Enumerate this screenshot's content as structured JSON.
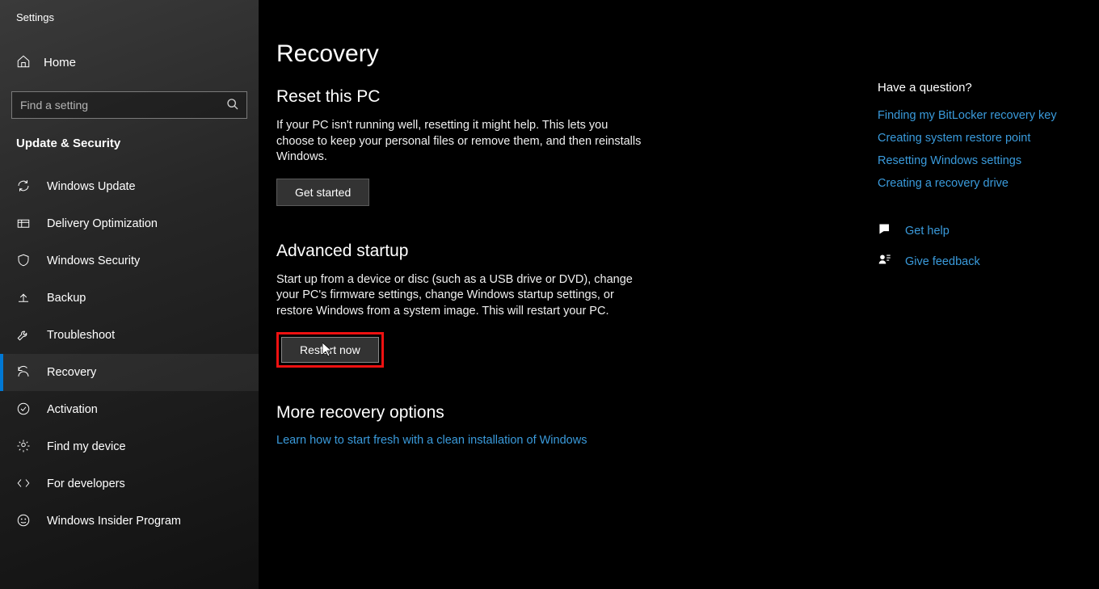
{
  "app_name": "Settings",
  "home_label": "Home",
  "search": {
    "placeholder": "Find a setting"
  },
  "section_label": "Update & Security",
  "sidebar": {
    "items": [
      {
        "label": "Windows Update"
      },
      {
        "label": "Delivery Optimization"
      },
      {
        "label": "Windows Security"
      },
      {
        "label": "Backup"
      },
      {
        "label": "Troubleshoot"
      },
      {
        "label": "Recovery"
      },
      {
        "label": "Activation"
      },
      {
        "label": "Find my device"
      },
      {
        "label": "For developers"
      },
      {
        "label": "Windows Insider Program"
      }
    ]
  },
  "page": {
    "title": "Recovery",
    "reset": {
      "heading": "Reset this PC",
      "body": "If your PC isn't running well, resetting it might help. This lets you choose to keep your personal files or remove them, and then reinstalls Windows.",
      "button": "Get started"
    },
    "advanced": {
      "heading": "Advanced startup",
      "body": "Start up from a device or disc (such as a USB drive or DVD), change your PC's firmware settings, change Windows startup settings, or restore Windows from a system image. This will restart your PC.",
      "button": "Restart now"
    },
    "more": {
      "heading": "More recovery options",
      "link": "Learn how to start fresh with a clean installation of Windows"
    }
  },
  "rail": {
    "question_heading": "Have a question?",
    "links": [
      "Finding my BitLocker recovery key",
      "Creating system restore point",
      "Resetting Windows settings",
      "Creating a recovery drive"
    ],
    "get_help": "Get help",
    "give_feedback": "Give feedback"
  }
}
